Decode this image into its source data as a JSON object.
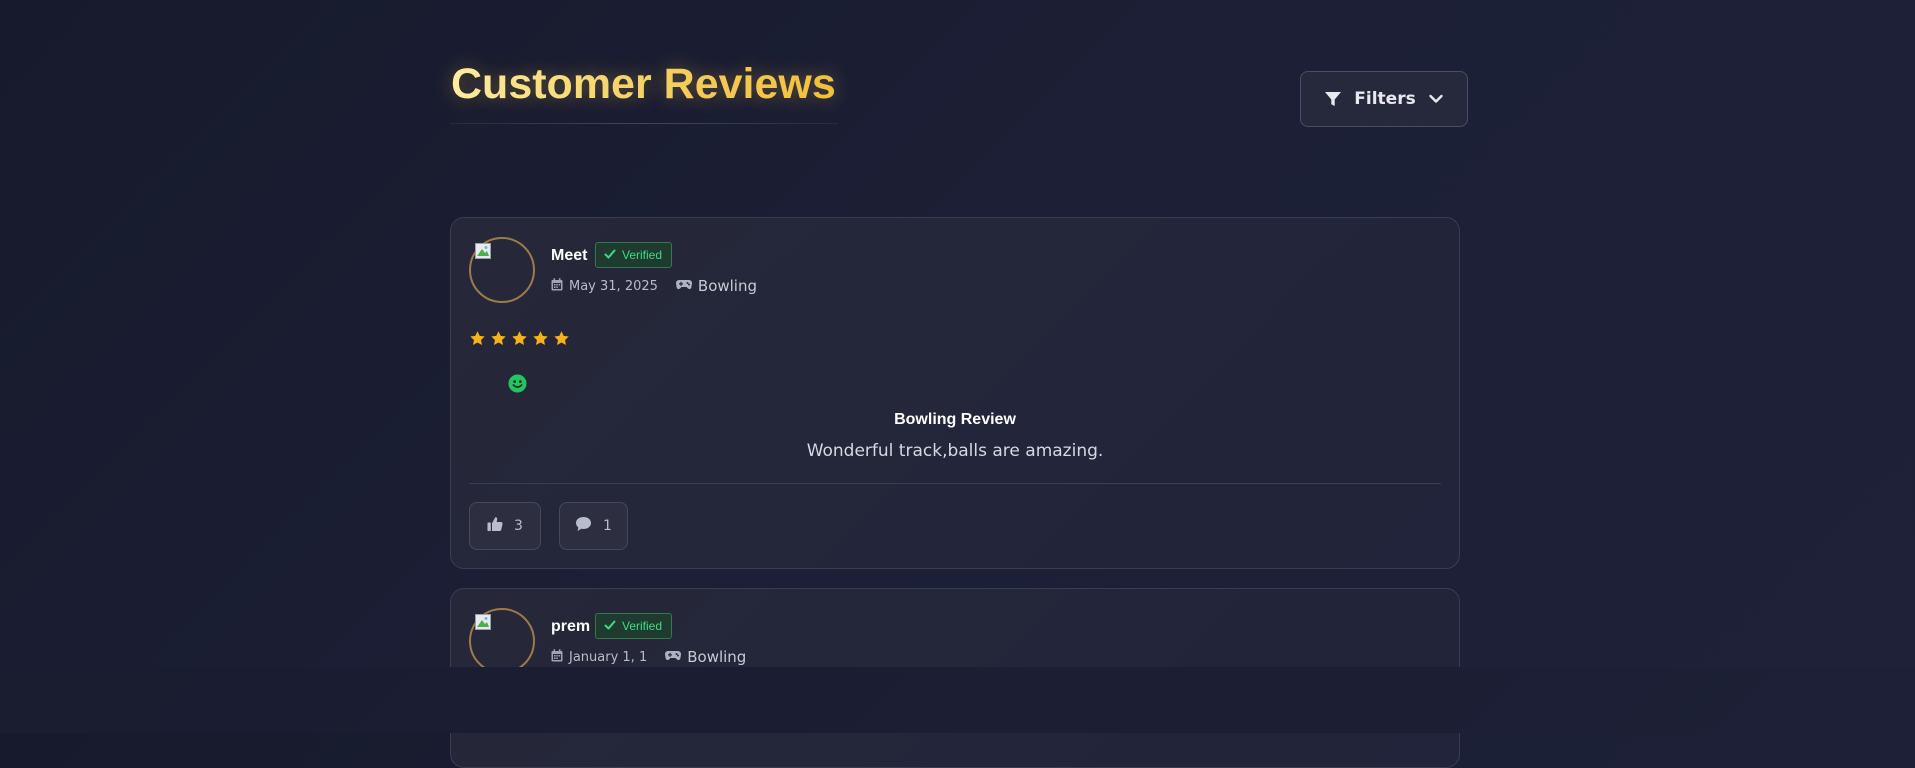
{
  "header": {
    "title": "Customer Reviews",
    "filters_label": "Filters"
  },
  "reviews": [
    {
      "name": "Meet",
      "badge": "Verified",
      "date": "May 31, 2025",
      "category": "Bowling",
      "rating": 5,
      "mood": "smile-icon",
      "title": "Bowling Review",
      "text": "Wonderful track,balls are amazing.",
      "likes": "3",
      "comments": "1"
    },
    {
      "name": "prem",
      "badge": "Verified",
      "date": "January 1, 1",
      "category": "Bowling"
    }
  ],
  "colors": {
    "accent": "#f6d062",
    "verified": "#3ddc84",
    "star": "#f5b21b",
    "mood": "#22c55e"
  }
}
